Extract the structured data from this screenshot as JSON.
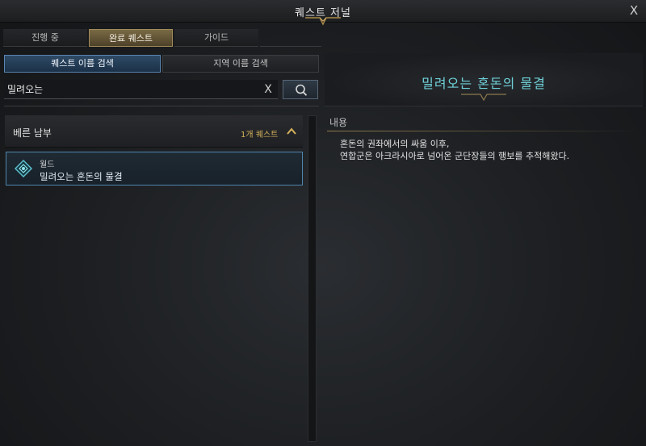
{
  "window": {
    "title": "퀘스트 저널",
    "close_label": "X"
  },
  "tabs": [
    {
      "label": "진행 중",
      "active": false
    },
    {
      "label": "완료 퀘스트",
      "active": true
    },
    {
      "label": "가이드",
      "active": false
    }
  ],
  "search_modes": [
    {
      "label": "퀘스트 이름 검색",
      "active": true
    },
    {
      "label": "지역 이름 검색",
      "active": false
    }
  ],
  "search": {
    "value": "밀려오는",
    "clear_label": "X"
  },
  "region": {
    "name": "베른 남부",
    "count": "1개 퀘스트",
    "expanded": true
  },
  "quest": {
    "type": "월드",
    "title": "밀려오는 혼돈의 물결"
  },
  "detail": {
    "title": "밀려오는 혼돈의 물결",
    "section_label": "내용",
    "lines": [
      "혼돈의 권좌에서의 싸움 이후,",
      "연합군은 아크라시아로 넘어온 군단장들의 행보를 추적해왔다."
    ]
  },
  "colors": {
    "accent_gold": "#d6b25a",
    "active_tab": "#7a6a45",
    "active_mode": "#2e4a66",
    "quest_border": "#4f86ad",
    "detail_title": "#6fd1d8"
  },
  "icons": {
    "close": "close-icon",
    "clear": "clear-icon",
    "search": "search-icon",
    "toggle": "chevron-up-icon",
    "quest": "world-quest-icon"
  }
}
